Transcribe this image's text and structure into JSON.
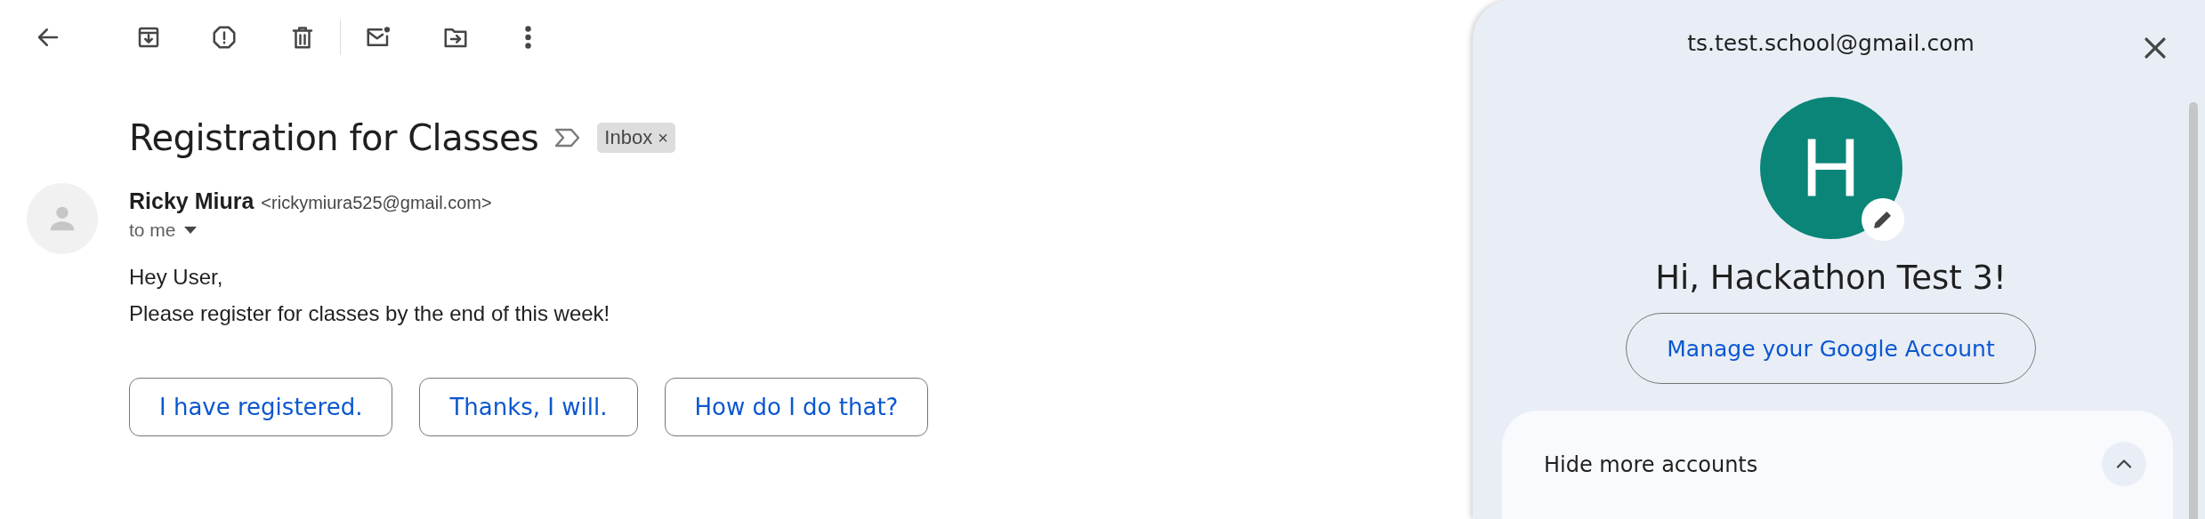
{
  "message": {
    "subject": "Registration for Classes",
    "labels": [
      {
        "text": "Inbox",
        "remove": "×"
      }
    ],
    "sender": {
      "name": "Ricky Miura",
      "address": "<rickymiura525@gmail.com>"
    },
    "recipient": "to me",
    "body": [
      "Hey User,",
      "Please register for classes by the end of this week!"
    ],
    "smart_replies": [
      "I have registered.",
      "Thanks, I will.",
      "How do I do that?"
    ]
  },
  "account_panel": {
    "email": "ts.test.school@gmail.com",
    "avatar_letter": "H",
    "greeting": "Hi, Hackathon Test 3!",
    "manage_button": "Manage your Google Account",
    "more_accounts": {
      "label": "Hide more accounts",
      "expanded": true
    }
  }
}
